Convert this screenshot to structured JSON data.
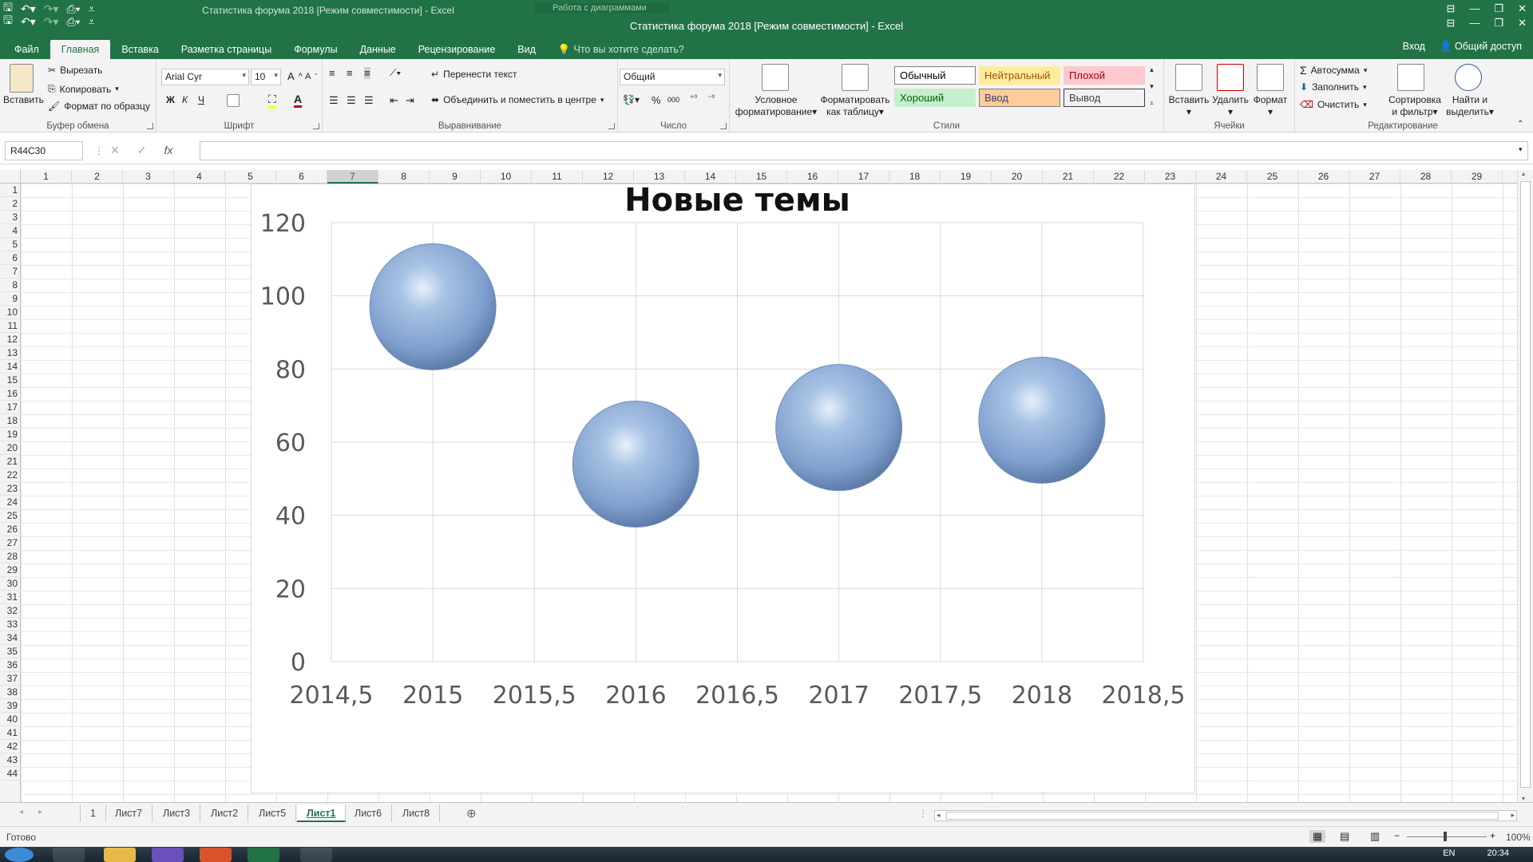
{
  "window": {
    "qat_icons": [
      "save-icon",
      "undo-icon",
      "redo-icon",
      "print-preview-icon"
    ],
    "ghost_title": "Статистика форума 2018  [Режим совместимости] - Excel",
    "ghost_context": "Работа с диаграммами",
    "title": "Статистика форума 2018  [Режим совместимости] - Excel",
    "controls": [
      "⊟",
      "—",
      "❐",
      "✕"
    ]
  },
  "tabs": {
    "items": [
      "Файл",
      "Главная",
      "Вставка",
      "Разметка страницы",
      "Формулы",
      "Данные",
      "Рецензирование",
      "Вид"
    ],
    "active": "Главная",
    "tell_me": "Что вы хотите сделать?",
    "login": "Вход",
    "share": "Общий доступ"
  },
  "ribbon": {
    "clipboard": {
      "paste": "Вставить",
      "cut": "Вырезать",
      "copy": "Копировать",
      "format_painter": "Формат по образцу",
      "label": "Буфер обмена"
    },
    "font": {
      "name": "Arial Cyr",
      "size": "10",
      "bold": "Ж",
      "italic": "К",
      "underline": "Ч",
      "grow": "A",
      "shrink": "A",
      "label": "Шрифт"
    },
    "alignment": {
      "wrap": "Перенести текст",
      "merge": "Объединить и поместить в центре",
      "label": "Выравнивание"
    },
    "number": {
      "format": "Общий",
      "percent": "%",
      "thousands": "000",
      "label": "Число"
    },
    "styles": {
      "conditional": [
        "Условное",
        "форматирование"
      ],
      "as_table": [
        "Форматировать",
        "как таблицу"
      ],
      "items": [
        {
          "name": "Обычный",
          "bg": "#ffffff",
          "fg": "#000000",
          "border": "#7f7f7f"
        },
        {
          "name": "Нейтральный",
          "bg": "#ffeb9c",
          "fg": "#9c5700",
          "border": "#ffeb9c"
        },
        {
          "name": "Плохой",
          "bg": "#ffc7ce",
          "fg": "#9c0006",
          "border": "#ffc7ce"
        },
        {
          "name": "Хороший",
          "bg": "#c6efce",
          "fg": "#006100",
          "border": "#c6efce"
        },
        {
          "name": "Ввод",
          "bg": "#ffcc99",
          "fg": "#3f3f76",
          "border": "#7f7f7f"
        },
        {
          "name": "Вывод",
          "bg": "#f2f2f2",
          "fg": "#3f3f3f",
          "border": "#3f3f3f"
        }
      ],
      "label": "Стили"
    },
    "cells": {
      "insert": "Вставить",
      "delete": "Удалить",
      "format": "Формат",
      "label": "Ячейки"
    },
    "editing": {
      "autosum": "Автосумма",
      "fill": "Заполнить",
      "clear": "Очистить",
      "sort": [
        "Сортировка",
        "и фильтр"
      ],
      "find": [
        "Найти и",
        "выделить"
      ],
      "label": "Редактирование"
    }
  },
  "formula_bar": {
    "name_box": "R44C30",
    "fx": "fx",
    "value": ""
  },
  "columns": [
    "1",
    "2",
    "3",
    "4",
    "5",
    "6",
    "7",
    "8",
    "9",
    "10",
    "11",
    "12",
    "13",
    "14",
    "15",
    "16",
    "17",
    "18",
    "19",
    "20",
    "21",
    "22",
    "23",
    "24",
    "25",
    "26",
    "27",
    "28",
    "29"
  ],
  "selected_column": "7",
  "rows": [
    "1",
    "2",
    "3",
    "4",
    "5",
    "6",
    "7",
    "8",
    "9",
    "10",
    "11",
    "12",
    "13",
    "14",
    "15",
    "16",
    "17",
    "18",
    "19",
    "20",
    "21",
    "22",
    "23",
    "24",
    "25",
    "26",
    "27",
    "28",
    "29",
    "30",
    "31",
    "32",
    "33",
    "34",
    "35",
    "36",
    "37",
    "38",
    "39",
    "40",
    "41",
    "42",
    "43",
    "44"
  ],
  "chart_data": {
    "type": "scatter",
    "variant": "bubble-3d",
    "title": "Новые темы",
    "xlabel": "",
    "ylabel": "",
    "x": [
      2015,
      2016,
      2017,
      2018
    ],
    "y": [
      97,
      54,
      64,
      66
    ],
    "xlim": [
      2014.5,
      2018.5
    ],
    "ylim": [
      0,
      120
    ],
    "x_ticks": [
      "2014,5",
      "2015",
      "2015,5",
      "2016",
      "2016,5",
      "2017",
      "2017,5",
      "2018",
      "2018,5"
    ],
    "y_ticks": [
      "0",
      "20",
      "40",
      "60",
      "80",
      "100",
      "120"
    ],
    "grid": true,
    "legend": "none",
    "bubble_color": "#7f9fce"
  },
  "sheets": {
    "items": [
      "1",
      "Лист7",
      "Лист3",
      "Лист2",
      "Лист5",
      "Лист1",
      "Лист6",
      "Лист8"
    ],
    "active": "Лист1"
  },
  "status": {
    "ready": "Готово",
    "zoom": "100%"
  },
  "taskbar": {
    "lang": "EN",
    "time": "20:34"
  }
}
